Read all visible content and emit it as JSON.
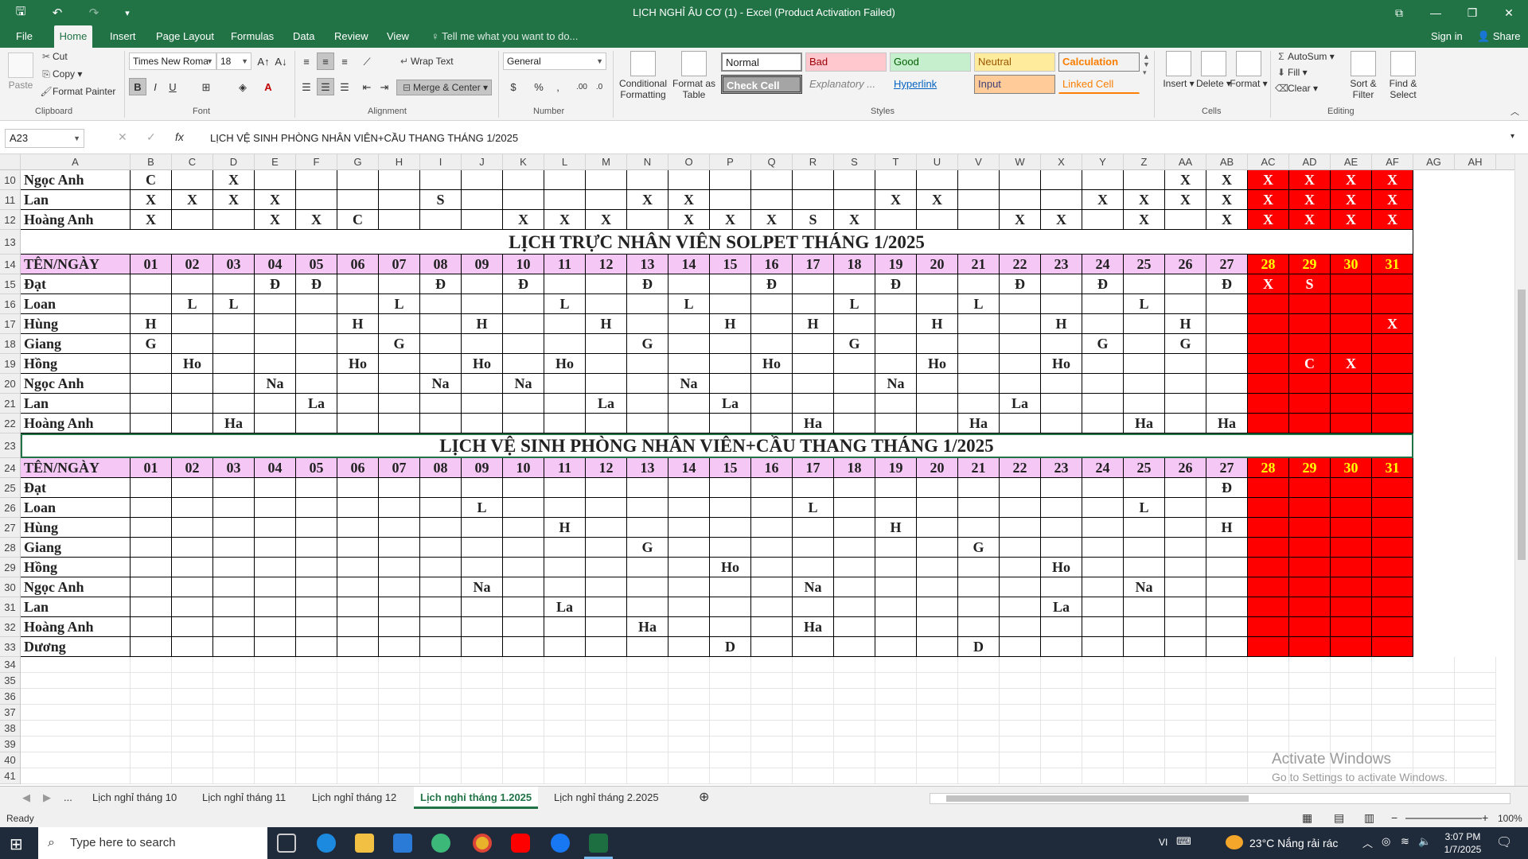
{
  "window": {
    "title": "LỊCH NGHỈ ÂU CƠ (1) - Excel (Product Activation Failed)",
    "signin": "Sign in",
    "share": "Share"
  },
  "tabs": [
    "File",
    "Home",
    "Insert",
    "Page Layout",
    "Formulas",
    "Data",
    "Review",
    "View"
  ],
  "tellme": "Tell me what you want to do...",
  "ribbon": {
    "clipboard": {
      "paste": "Paste",
      "cut": "Cut",
      "copy": "Copy",
      "painter": "Format Painter",
      "label": "Clipboard"
    },
    "font": {
      "name": "Times New Roma",
      "size": "18",
      "label": "Font"
    },
    "alignment": {
      "wrap": "Wrap Text",
      "merge": "Merge & Center",
      "label": "Alignment"
    },
    "number": {
      "format": "General",
      "label": "Number"
    },
    "styles": {
      "conditional": "Conditional Formatting",
      "format_table": "Format as Table",
      "normal": "Normal",
      "bad": "Bad",
      "good": "Good",
      "neutral": "Neutral",
      "calculation": "Calculation",
      "check": "Check Cell",
      "explanatory": "Explanatory ...",
      "hyperlink": "Hyperlink",
      "input": "Input",
      "linked": "Linked Cell",
      "label": "Styles"
    },
    "cells": {
      "insert": "Insert",
      "delete": "Delete",
      "format": "Format",
      "label": "Cells"
    },
    "editing": {
      "autosum": "AutoSum",
      "fill": "Fill",
      "clear": "Clear",
      "sort": "Sort & Filter",
      "find": "Find & Select",
      "label": "Editing"
    }
  },
  "namebox": "A23",
  "formula": "LỊCH VỆ SINH PHÒNG NHÂN VIÊN+CẦU THANG THÁNG 1/2025",
  "columns": [
    "A",
    "B",
    "C",
    "D",
    "E",
    "F",
    "G",
    "H",
    "I",
    "J",
    "K",
    "L",
    "M",
    "N",
    "O",
    "P",
    "Q",
    "R",
    "S",
    "T",
    "U",
    "V",
    "W",
    "X",
    "Y",
    "Z",
    "AA",
    "AB",
    "AC",
    "AD",
    "AE",
    "AF",
    "AG",
    "AH"
  ],
  "days": [
    "01",
    "02",
    "03",
    "04",
    "05",
    "06",
    "07",
    "08",
    "09",
    "10",
    "11",
    "12",
    "13",
    "14",
    "15",
    "16",
    "17",
    "18",
    "19",
    "20",
    "21",
    "22",
    "23",
    "24",
    "25",
    "26",
    "27",
    "28",
    "29",
    "30",
    "31"
  ],
  "header_label": "TÊN/NGÀY",
  "title1": "LỊCH TRỰC NHÂN VIÊN SOLPET THÁNG 1/2025",
  "title2": "LỊCH VỆ SINH PHÒNG NHÂN VIÊN+CẦU THANG THÁNG 1/2025",
  "rows_top": [
    {
      "row": "10",
      "name": "Ngọc Anh",
      "cells": {
        "1": "C",
        "3": "X",
        "26": "X",
        "27": "X",
        "28": "X",
        "29": "X",
        "30": "X",
        "31": "X"
      }
    },
    {
      "row": "11",
      "name": "Lan",
      "cells": {
        "1": "X",
        "2": "X",
        "3": "X",
        "4": "X",
        "8": "S",
        "13": "X",
        "14": "X",
        "19": "X",
        "20": "X",
        "24": "X",
        "25": "X",
        "26": "X",
        "27": "X",
        "28": "X",
        "29": "X",
        "30": "X",
        "31": "X"
      }
    },
    {
      "row": "12",
      "name": "Hoàng Anh",
      "cells": {
        "1": "X",
        "4": "X",
        "5": "X",
        "6": "C",
        "10": "X",
        "11": "X",
        "12": "X",
        "14": "X",
        "15": "X",
        "16": "X",
        "17": "S",
        "18": "X",
        "22": "X",
        "23": "X",
        "25": "X",
        "27": "X",
        "28": "X",
        "29": "X",
        "30": "X",
        "31": "X"
      }
    }
  ],
  "rows_duty": [
    {
      "row": "15",
      "name": "Đạt",
      "cells": {
        "4": "Đ",
        "5": "Đ",
        "8": "Đ",
        "10": "Đ",
        "13": "Đ",
        "16": "Đ",
        "19": "Đ",
        "22": "Đ",
        "24": "Đ",
        "27": "Đ",
        "28": "X",
        "29": "S"
      }
    },
    {
      "row": "16",
      "name": "Loan",
      "cells": {
        "2": "L",
        "3": "L",
        "7": "L",
        "11": "L",
        "14": "L",
        "18": "L",
        "21": "L",
        "25": "L"
      }
    },
    {
      "row": "17",
      "name": "Hùng",
      "cells": {
        "1": "H",
        "6": "H",
        "9": "H",
        "12": "H",
        "15": "H",
        "17": "H",
        "20": "H",
        "23": "H",
        "26": "H",
        "31": "X"
      }
    },
    {
      "row": "18",
      "name": "Giang",
      "cells": {
        "1": "G",
        "7": "G",
        "13": "G",
        "18": "G",
        "24": "G",
        "26": "G"
      }
    },
    {
      "row": "19",
      "name": "Hồng",
      "cells": {
        "2": "Ho",
        "6": "Ho",
        "9": "Ho",
        "11": "Ho",
        "16": "Ho",
        "20": "Ho",
        "23": "Ho",
        "29": "C",
        "30": "X"
      }
    },
    {
      "row": "20",
      "name": "Ngọc Anh",
      "cells": {
        "4": "Na",
        "8": "Na",
        "10": "Na",
        "14": "Na",
        "19": "Na"
      }
    },
    {
      "row": "21",
      "name": "Lan",
      "cells": {
        "5": "La",
        "12": "La",
        "15": "La",
        "22": "La"
      }
    },
    {
      "row": "22",
      "name": "Hoàng Anh",
      "cells": {
        "3": "Ha",
        "17": "Ha",
        "21": "Ha",
        "25": "Ha",
        "27": "Ha"
      }
    }
  ],
  "rows_clean": [
    {
      "row": "25",
      "name": "Đạt",
      "cells": {
        "27": "Đ"
      }
    },
    {
      "row": "26",
      "name": "Loan",
      "cells": {
        "9": "L",
        "17": "L",
        "25": "L"
      }
    },
    {
      "row": "27",
      "name": "Hùng",
      "cells": {
        "11": "H",
        "19": "H",
        "27": "H"
      }
    },
    {
      "row": "28",
      "name": "Giang",
      "cells": {
        "13": "G",
        "21": "G"
      }
    },
    {
      "row": "29",
      "name": "Hồng",
      "cells": {
        "15": "Ho",
        "23": "Ho"
      }
    },
    {
      "row": "30",
      "name": "Ngọc Anh",
      "cells": {
        "9": "Na",
        "17": "Na",
        "25": "Na"
      }
    },
    {
      "row": "31",
      "name": "Lan",
      "cells": {
        "11": "La",
        "23": "La"
      }
    },
    {
      "row": "32",
      "name": "Hoàng Anh",
      "cells": {
        "13": "Ha",
        "17": "Ha"
      }
    },
    {
      "row": "33",
      "name": "Dương",
      "cells": {
        "15": "D",
        "21": "D"
      }
    }
  ],
  "row_numbers": {
    "title1": "13",
    "head1": "14",
    "title2": "23",
    "head2": "24",
    "empty": [
      "34",
      "35",
      "36",
      "37",
      "38",
      "39",
      "40",
      "41"
    ]
  },
  "sheets": [
    "Lịch nghỉ tháng 10",
    "Lịch nghỉ tháng 11",
    "Lịch nghỉ tháng 12",
    "Lịch nghỉ tháng 1.2025",
    "Lịch nghỉ tháng 2.2025"
  ],
  "sheets_more": "...",
  "status": {
    "ready": "Ready",
    "zoom": "100%"
  },
  "watermark": {
    "line1": "Activate Windows",
    "line2": "Go to Settings to activate Windows."
  },
  "taskbar": {
    "search": "Type here to search",
    "lang": "VI",
    "weather": "23°C  Nắng rải rác",
    "time": "3:07 PM",
    "date": "1/7/2025"
  },
  "colors": {
    "excel_green": "#217346",
    "header_pink": "#f4c7f4",
    "weekend_red": "#ff0000",
    "weekend_text": "#ffff00"
  }
}
